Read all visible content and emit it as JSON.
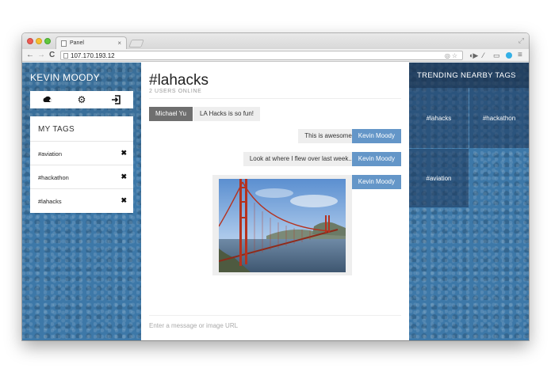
{
  "browser": {
    "tab_title": "Panel",
    "url": "107.170.193.12",
    "back_icon": "←",
    "forward_icon": "→",
    "reload_icon": "C"
  },
  "sidebar": {
    "user_name": "KEVIN MOODY",
    "tags_heading": "MY TAGS",
    "tags": [
      "#aviation",
      "#hackathon",
      "#lahacks"
    ],
    "remove_icon": "✖"
  },
  "chat": {
    "room": "#lahacks",
    "online": "2 USERS ONLINE",
    "messages": [
      {
        "sender": "Michael Yu",
        "text": "LA Hacks is so fun!"
      },
      {
        "sender": "Kevin Moody",
        "text": "This is awesome!"
      },
      {
        "sender": "Kevin Moody",
        "text": "Look at where I flew over last week..."
      },
      {
        "sender": "Kevin Moody",
        "text": ""
      }
    ],
    "input_placeholder": "Enter a message or image URL"
  },
  "trending": {
    "heading": "TRENDING NEARBY TAGS",
    "tags": [
      "#lahacks",
      "#hackathon",
      "#aviation"
    ]
  },
  "colors": {
    "accent": "#6496c8",
    "other_sender": "#6f6f6f",
    "bubble": "#eeeeee"
  }
}
